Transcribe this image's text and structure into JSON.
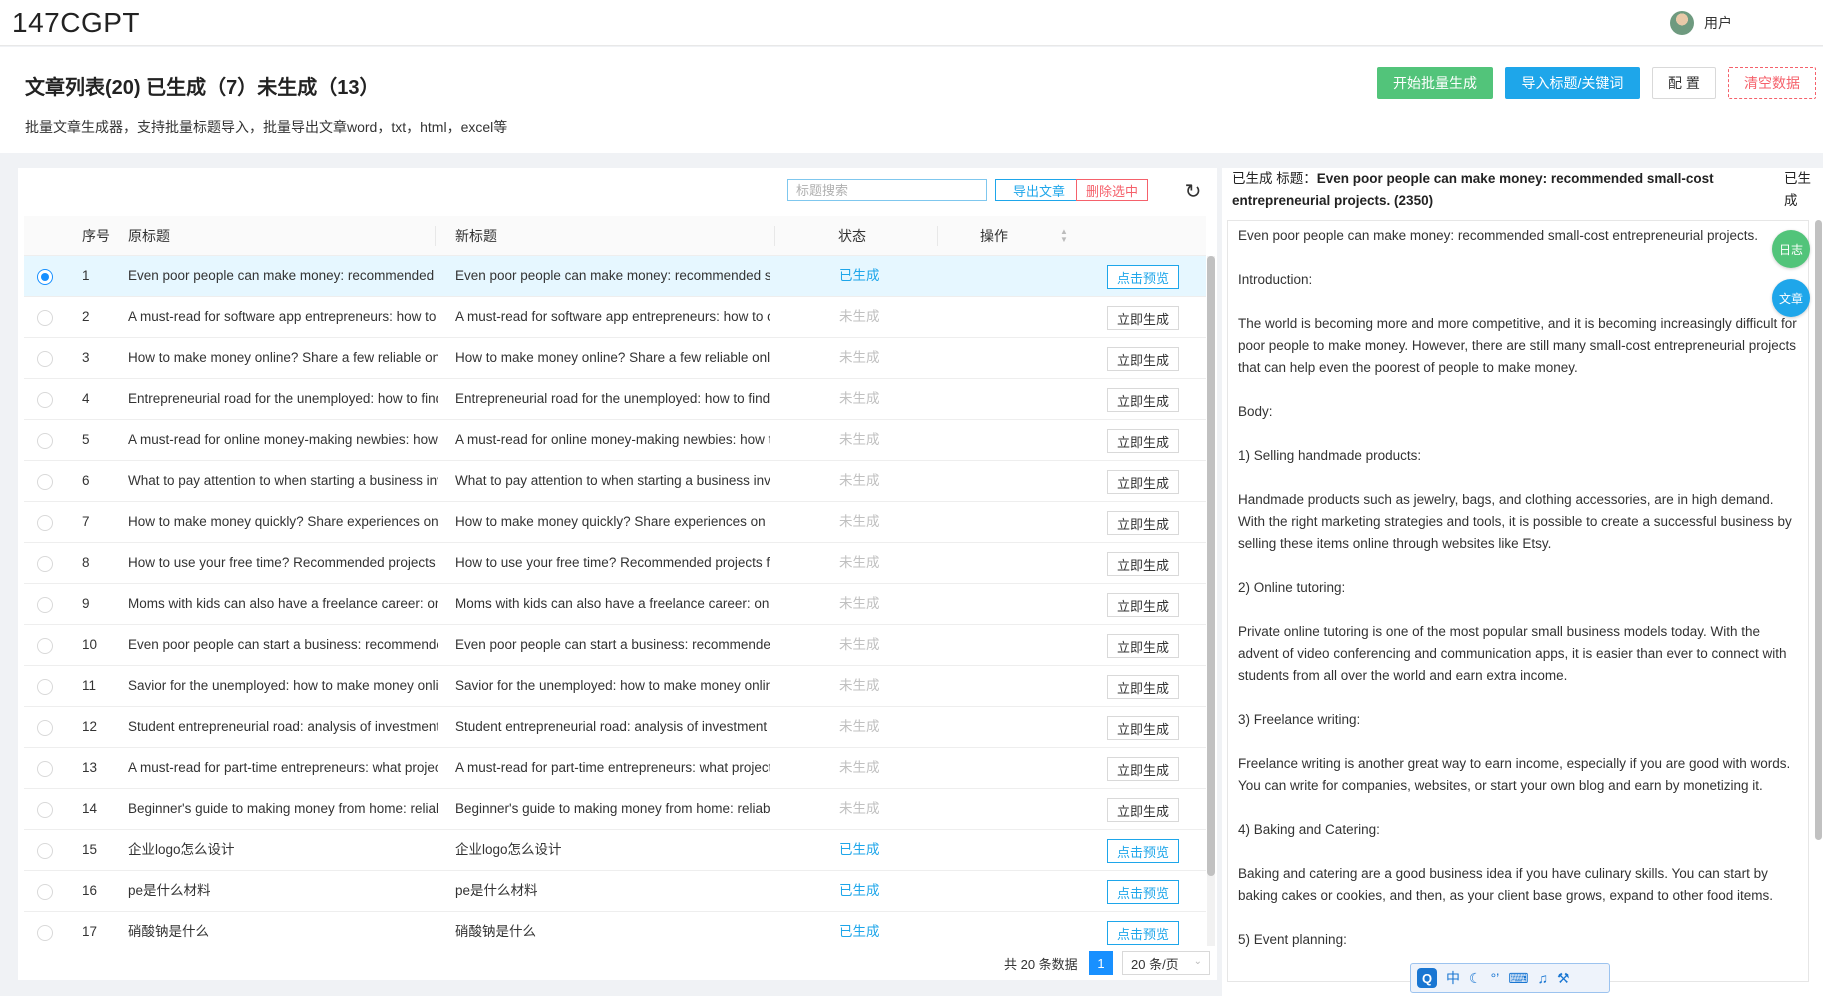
{
  "app": {
    "logo": "147CGPT",
    "user_label": "用户"
  },
  "header": {
    "title": "文章列表(20) 已生成（7）未生成（13）",
    "subtitle": "批量文章生成器，支持批量标题导入，批量导出文章word，txt，html，excel等",
    "buttons": {
      "batch_generate": "开始批量生成",
      "import": "导入标题/关键词",
      "config": "配 置",
      "clear": "清空数据"
    }
  },
  "toolbar": {
    "search_placeholder": "标题搜索",
    "export": "导出文章",
    "delete": "删除选中",
    "refresh_icon": "refresh-icon"
  },
  "table": {
    "columns": {
      "index": "序号",
      "original": "原标题",
      "new": "新标题",
      "status": "状态",
      "action": "操作"
    },
    "rows": [
      {
        "index": "1",
        "original": "Even poor people can make money: recommended small...",
        "new": "Even poor people can make money: recommended small...",
        "status": "已生成",
        "action": "点击预览",
        "done": true,
        "selected": true
      },
      {
        "index": "2",
        "original": "A must-read for software app entrepreneurs: how to cho...",
        "new": "A must-read for software app entrepreneurs: how to cho...",
        "status": "未生成",
        "action": "立即生成",
        "done": false,
        "selected": false
      },
      {
        "index": "3",
        "original": "How to make money online? Share a few reliable online ...",
        "new": "How to make money online? Share a few reliable online ...",
        "status": "未生成",
        "action": "立即生成",
        "done": false,
        "selected": false
      },
      {
        "index": "4",
        "original": "Entrepreneurial road for the unemployed: how to find sui...",
        "new": "Entrepreneurial road for the unemployed: how to find sui...",
        "status": "未生成",
        "action": "立即生成",
        "done": false,
        "selected": false
      },
      {
        "index": "5",
        "original": "A must-read for online money-making newbies: how to c...",
        "new": "A must-read for online money-making newbies: how to c...",
        "status": "未生成",
        "action": "立即生成",
        "done": false,
        "selected": false
      },
      {
        "index": "6",
        "original": "What to pay attention to when starting a business invest...",
        "new": "What to pay attention to when starting a business invest...",
        "status": "未生成",
        "action": "立即生成",
        "done": false,
        "selected": false
      },
      {
        "index": "7",
        "original": "How to make money quickly? Share experiences on onlin...",
        "new": "How to make money quickly? Share experiences on onlin...",
        "status": "未生成",
        "action": "立即生成",
        "done": false,
        "selected": false
      },
      {
        "index": "8",
        "original": "How to use your free time? Recommended projects for ...",
        "new": "How to use your free time? Recommended projects for ...",
        "status": "未生成",
        "action": "立即生成",
        "done": false,
        "selected": false
      },
      {
        "index": "9",
        "original": "Moms with kids can also have a freelance career: online ...",
        "new": "Moms with kids can also have a freelance career: online ...",
        "status": "未生成",
        "action": "立即生成",
        "done": false,
        "selected": false
      },
      {
        "index": "10",
        "original": "Even poor people can start a business: recommended pr...",
        "new": "Even poor people can start a business: recommended pr...",
        "status": "未生成",
        "action": "立即生成",
        "done": false,
        "selected": false
      },
      {
        "index": "11",
        "original": "Savior for the unemployed: how to make money online a...",
        "new": "Savior for the unemployed: how to make money online a...",
        "status": "未生成",
        "action": "立即生成",
        "done": false,
        "selected": false
      },
      {
        "index": "12",
        "original": "Student entrepreneurial road: analysis of investment indu...",
        "new": "Student entrepreneurial road: analysis of investment indu...",
        "status": "未生成",
        "action": "立即生成",
        "done": false,
        "selected": false
      },
      {
        "index": "13",
        "original": "A must-read for part-time entrepreneurs: what projects c...",
        "new": "A must-read for part-time entrepreneurs: what projects c...",
        "status": "未生成",
        "action": "立即生成",
        "done": false,
        "selected": false
      },
      {
        "index": "14",
        "original": "Beginner's guide to making money from home: reliable o...",
        "new": "Beginner's guide to making money from home: reliable o...",
        "status": "未生成",
        "action": "立即生成",
        "done": false,
        "selected": false
      },
      {
        "index": "15",
        "original": "企业logo怎么设计",
        "new": "企业logo怎么设计",
        "status": "已生成",
        "action": "点击预览",
        "done": true,
        "selected": false
      },
      {
        "index": "16",
        "original": "pe是什么材料",
        "new": "pe是什么材料",
        "status": "已生成",
        "action": "点击预览",
        "done": true,
        "selected": false
      },
      {
        "index": "17",
        "original": "硝酸钠是什么",
        "new": "硝酸钠是什么",
        "status": "已生成",
        "action": "点击预览",
        "done": true,
        "selected": false
      }
    ]
  },
  "pagination": {
    "total": "共 20 条数据",
    "current_page": "1",
    "page_size": "20 条/页"
  },
  "detail": {
    "label": "已生成 标题：",
    "title": "Even poor people can make money: recommended small-cost entrepreneurial projects. (2350)",
    "flag": "已生成",
    "paragraphs": [
      "Even poor people can make money: recommended small-cost entrepreneurial projects.",
      "Introduction:",
      "The world is becoming more and more competitive, and it is becoming increasingly difficult for poor people to make money. However, there are still many small-cost entrepreneurial projects that can help even the poorest of people to make money.",
      "Body:",
      "1) Selling handmade products:",
      "Handmade products such as jewelry, bags, and clothing accessories, are in high demand. With the right marketing strategies and tools, it is possible to create a successful business by selling these items online through websites like Etsy.",
      "2) Online tutoring:",
      "Private online tutoring is one of the most popular small business models today. With the advent of video conferencing and communication apps, it is easier than ever to connect with students from all over the world and earn extra income.",
      "3) Freelance writing:",
      "Freelance writing is another great way to earn income, especially if you are good with words. You can write for companies, websites, or start your own blog and earn by monetizing it.",
      "4) Baking and Catering:",
      "Baking and catering are a good business idea if you have culinary skills. You can start by baking cakes or cookies, and then, as your client base grows, expand to other food items.",
      "5) Event planning:"
    ]
  },
  "float_buttons": {
    "log": "日志",
    "article": "文章"
  },
  "ime": {
    "logo": "Q",
    "mode": "中"
  }
}
